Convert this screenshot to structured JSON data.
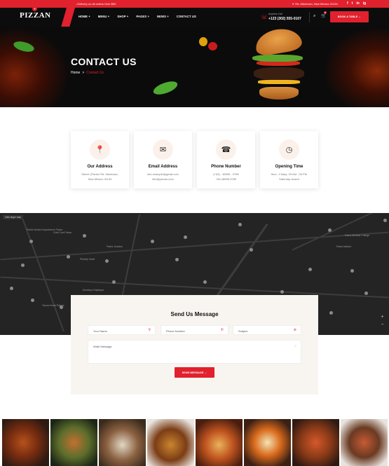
{
  "topbar": {
    "promo": "Free Delivery on all orders Over $50",
    "address": "Rd. Allentown, New Mexico 31134",
    "social": [
      "f",
      "t",
      "in",
      "ig"
    ]
  },
  "header": {
    "logo": "PIZZAN",
    "nav": [
      "HOME +",
      "MENU +",
      "SHOP +",
      "PAGES +",
      "NEWS +",
      "CONTACT US"
    ],
    "phone_label": "Anytime Call",
    "phone": "+123 (302) 555-0107",
    "cart_count": "0",
    "book_label": "BOOK A TABLE →"
  },
  "hero": {
    "title": "CONTACT US",
    "breadcrumb_home": "Home",
    "breadcrumb_sep": ">",
    "breadcrumb_current": "Contact Us"
  },
  "cards": [
    {
      "icon": "map-pin-icon",
      "title": "Our Address",
      "line1": "Street: (Parker Rd. Allentown,",
      "line2": "New Mexico 31134"
    },
    {
      "icon": "email-icon",
      "title": "Email Address",
      "line1": "info.example@gmail.com",
      "line2": "info@pizzan.com"
    },
    {
      "icon": "phone-icon",
      "title": "Phone Number",
      "line1": "(+63) - 48596 - 5789",
      "line2": "+63-48596-5789"
    },
    {
      "icon": "clock-icon",
      "title": "Opening Time",
      "line1": "Mon - Friday: 09 AM - 06 PM",
      "line2": "Saturday closed"
    }
  ],
  "map": {
    "view_label": "View larger map",
    "labels": [
      "Public Works Department, Patna",
      "Gold Coin Patna",
      "Pinkcity Hotel",
      "Patna Medical College",
      "Vidya Bhawan School",
      "Patna Junction",
      "Kendriya Vidyalaya",
      "Tanna Home Palace",
      "Patna Market"
    ]
  },
  "form": {
    "title": "Send Us Message",
    "name_placeholder": "Your Name",
    "phone_placeholder": "Phone Number",
    "subject_placeholder": "Subject",
    "message_placeholder": "Write Message",
    "send_label": "SEND MESSAGE →"
  },
  "gallery": [
    "roast-chicken",
    "chicken-plate",
    "grilled-meat",
    "burger",
    "pizza",
    "egg-dish",
    "pasta",
    "skewers"
  ]
}
